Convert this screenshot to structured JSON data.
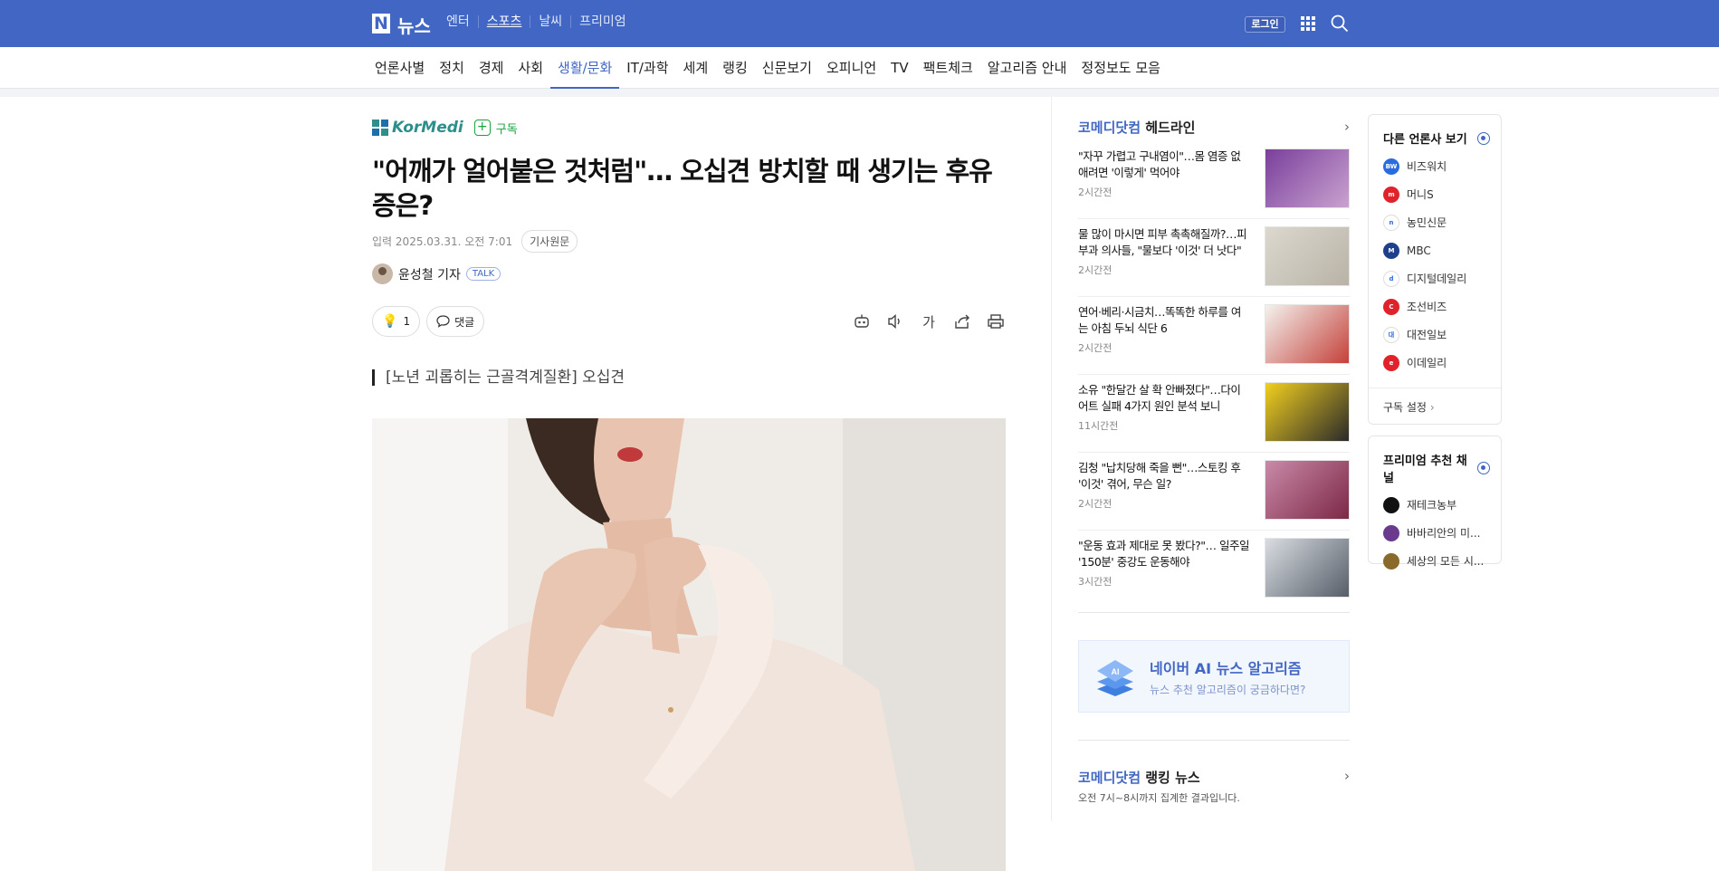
{
  "header": {
    "logo_n": "N",
    "logo_text": "뉴스",
    "gnb": [
      {
        "label": "엔터",
        "active": false
      },
      {
        "label": "스포츠",
        "active": true
      },
      {
        "label": "날씨",
        "active": false
      },
      {
        "label": "프리미엄",
        "active": false
      }
    ],
    "login": "로그인"
  },
  "subnav": [
    {
      "label": "언론사별",
      "active": false
    },
    {
      "label": "정치",
      "active": false
    },
    {
      "label": "경제",
      "active": false
    },
    {
      "label": "사회",
      "active": false
    },
    {
      "label": "생활/문화",
      "active": true
    },
    {
      "label": "IT/과학",
      "active": false
    },
    {
      "label": "세계",
      "active": false
    },
    {
      "label": "랭킹",
      "active": false
    },
    {
      "label": "신문보기",
      "active": false
    },
    {
      "label": "오피니언",
      "active": false
    },
    {
      "label": "TV",
      "active": false
    },
    {
      "label": "팩트체크",
      "active": false
    },
    {
      "label": "알고리즘 안내",
      "active": false
    },
    {
      "label": "정정보도 모음",
      "active": false
    }
  ],
  "article": {
    "press": "KorMedi",
    "subscribe": "구독",
    "headline": "\"어깨가 얼어붙은 것처럼\"… 오십견 방치할 때 생기는 후유증은?",
    "meta_label": "입력",
    "date": "2025.03.31. 오전 7:01",
    "original_btn": "기사원문",
    "author": "윤성철 기자",
    "talk": "TALK",
    "reaction_count": "1",
    "comment_label": "댓글",
    "font_label": "가",
    "subtitle": "[노년 괴롭히는 근골격계질환] 오십견"
  },
  "sidebar": {
    "headline_brand": "코메디닷컴",
    "headline_suffix": "헤드라인",
    "news": [
      {
        "title": "\"자꾸 가렵고 구내염이\"…몸 염증 없애려면 '이렇게' 먹어야",
        "time": "2시간전"
      },
      {
        "title": "물 많이 마시면 피부 촉촉해질까?…피부과 의사들, \"물보다 '이것' 더 낫다\"",
        "time": "2시간전"
      },
      {
        "title": "연어·베리·시금치…똑똑한 하루를 여는 아침 두뇌 식단 6",
        "time": "2시간전"
      },
      {
        "title": "소유 \"한달간 살 확 안빠졌다\"…다이어트 실패 4가지 원인 분석 보니",
        "time": "11시간전"
      },
      {
        "title": "김청 \"납치당해 죽을 뻔\"…스토킹 후 '이것' 겪어, 무슨 일?",
        "time": "2시간전"
      },
      {
        "title": "\"운동 효과 제대로 못 봤다?\"… 일주일 '150분' 중강도 운동해야",
        "time": "3시간전"
      }
    ],
    "ai_title": "네이버 AI 뉴스 알고리즘",
    "ai_desc": "뉴스 추천 알고리즘이 궁금하다면?",
    "ranking_brand": "코메디닷컴",
    "ranking_suffix": "랭킹 뉴스",
    "ranking_sub": "오전 7시~8시까지 집계한 결과입니다."
  },
  "right_panel": {
    "other_press_title": "다른 언론사 보기",
    "other_press": [
      {
        "name": "비즈워치",
        "color": "#2b6be0",
        "mark": "BW"
      },
      {
        "name": "머니S",
        "color": "#e0232b",
        "mark": "m"
      },
      {
        "name": "농민신문",
        "color": "#ffffff",
        "mark": "n"
      },
      {
        "name": "MBC",
        "color": "#1e3f8c",
        "mark": "M"
      },
      {
        "name": "디지털데일리",
        "color": "#ffffff",
        "mark": "d"
      },
      {
        "name": "조선비즈",
        "color": "#e0232b",
        "mark": "C"
      },
      {
        "name": "대전일보",
        "color": "#ffffff",
        "mark": "대"
      },
      {
        "name": "이데일리",
        "color": "#e0232b",
        "mark": "e"
      }
    ],
    "subscribe_settings": "구독 설정",
    "premium_title": "프리미엄 추천 채널",
    "premium": [
      {
        "name": "재테크농부",
        "color": "#111111"
      },
      {
        "name": "바바리안의 미...",
        "color": "#6a3a8e"
      },
      {
        "name": "세상의 모든 시...",
        "color": "#8a6a2a"
      }
    ]
  }
}
